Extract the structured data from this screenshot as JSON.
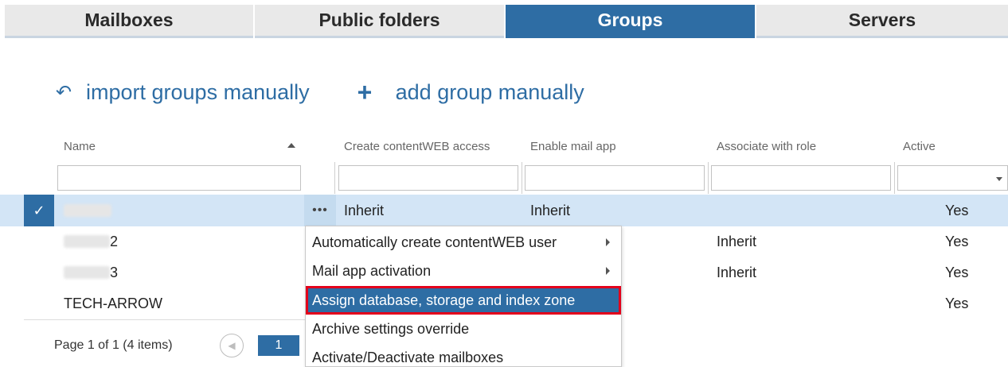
{
  "tabs": [
    {
      "label": "Mailboxes"
    },
    {
      "label": "Public folders"
    },
    {
      "label": "Groups",
      "active": true
    },
    {
      "label": "Servers"
    }
  ],
  "actions": {
    "import_label": "import groups manually",
    "import_icon": "undo-arrow-icon",
    "add_label": "add group manually",
    "add_icon": "plus-icon"
  },
  "grid": {
    "columns": [
      "Name",
      "Create contentWEB access",
      "Enable mail app",
      "Associate with role",
      "Active"
    ],
    "sort_column": "Name",
    "sort_direction": "ascending",
    "rows": [
      {
        "name": "",
        "create_access": "Inherit",
        "enable_mail_app": "Inherit",
        "role": "",
        "active": "Yes",
        "selected": true
      },
      {
        "name": "2",
        "create_access": "",
        "enable_mail_app": "",
        "role": "Inherit",
        "active": "Yes"
      },
      {
        "name": "3",
        "create_access": "",
        "enable_mail_app": "",
        "role": "Inherit",
        "active": "Yes"
      },
      {
        "name": "TECH-ARROW",
        "create_access": "",
        "enable_mail_app": "",
        "role": "",
        "active": "Yes"
      }
    ]
  },
  "row_menu_button": "•••",
  "context_menu": {
    "items": [
      {
        "label": "Automatically create contentWEB user",
        "has_submenu": true
      },
      {
        "label": "Mail app activation",
        "has_submenu": true
      },
      {
        "label": "Assign database, storage and index zone",
        "highlighted": true
      },
      {
        "label": "Archive settings override"
      },
      {
        "label": "Activate/Deactivate mailboxes"
      }
    ]
  },
  "pager": {
    "text": "Page 1 of 1 (4 items)",
    "current_page": "1"
  },
  "colors": {
    "accent": "#2e6da4",
    "selected_row": "#d3e5f6",
    "highlight_border": "#e3001b"
  }
}
